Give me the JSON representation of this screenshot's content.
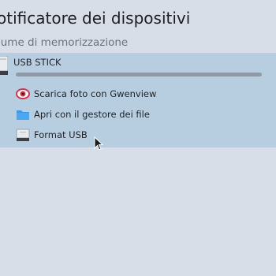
{
  "header": {
    "title": "otificatore dei dispositivi",
    "section": "lume di memorizzazione"
  },
  "device": {
    "name": "USB STICK",
    "icon": "usb-drive-icon",
    "usage_fraction": 1.0
  },
  "actions": [
    {
      "label": "Scarica foto con Gwenview",
      "icon": "gwenview-icon"
    },
    {
      "label": "Apri con il gestore dei file",
      "icon": "folder-icon"
    },
    {
      "label": "Format USB",
      "icon": "usb-drive-icon"
    }
  ],
  "colors": {
    "background": "#d8dee8",
    "panel_highlight": "#b7cde0",
    "folder_blue": "#3a9be6",
    "gwenview_red": "#d9334a"
  }
}
